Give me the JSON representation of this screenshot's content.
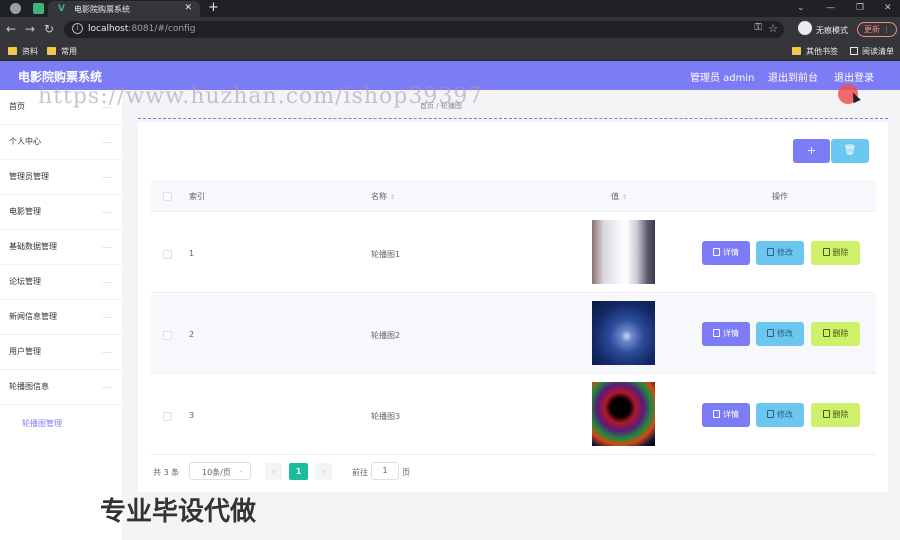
{
  "browser": {
    "tab_title": "电影院购票系统",
    "url_host": "localhost",
    "url_rest": ":8081/#/config",
    "incognito_label": "无痕模式",
    "update_label": "更新",
    "bookmarks": [
      "资料",
      "常用"
    ],
    "bookmarks_right": [
      "其他书签",
      "阅读清单"
    ]
  },
  "header": {
    "title": "电影院购票系统",
    "user": "管理员 admin",
    "to_front": "退出到前台",
    "logout": "退出登录"
  },
  "sidebar": {
    "items": [
      {
        "label": "首页"
      },
      {
        "label": "个人中心"
      },
      {
        "label": "管理员管理"
      },
      {
        "label": "电影管理"
      },
      {
        "label": "基础数据管理"
      },
      {
        "label": "论坛管理"
      },
      {
        "label": "新闻信息管理"
      },
      {
        "label": "用户管理"
      },
      {
        "label": "轮播图信息"
      }
    ],
    "sub_item": "轮播图管理"
  },
  "breadcrumb": {
    "home": "首页",
    "sep": "/",
    "current": "轮播图"
  },
  "table": {
    "columns": {
      "index": "索引",
      "name": "名称",
      "value": "值",
      "actions": "操作"
    },
    "rows": [
      {
        "index": "1",
        "name": "轮播图1"
      },
      {
        "index": "2",
        "name": "轮播图2"
      },
      {
        "index": "3",
        "name": "轮播图3"
      }
    ],
    "action_labels": {
      "detail": "详情",
      "edit": "修改",
      "delete": "删除"
    }
  },
  "toolbar": {
    "add_icon": "+",
    "delete_icon": "🗑"
  },
  "pagination": {
    "total": "共 3 条",
    "page_size": "10条/页",
    "prev": "‹",
    "current": "1",
    "next": "›",
    "goto": "前往",
    "goto_value": "1",
    "page_unit": "页"
  },
  "overlay": {
    "watermark": "https://www.huzhan.com/ishop39397",
    "bottom_text": "专业毕设代做"
  },
  "colors": {
    "brand": "#7b7cf6",
    "edit": "#6cc7f0",
    "delete": "#cff06b",
    "page_active": "#1abc9c"
  }
}
